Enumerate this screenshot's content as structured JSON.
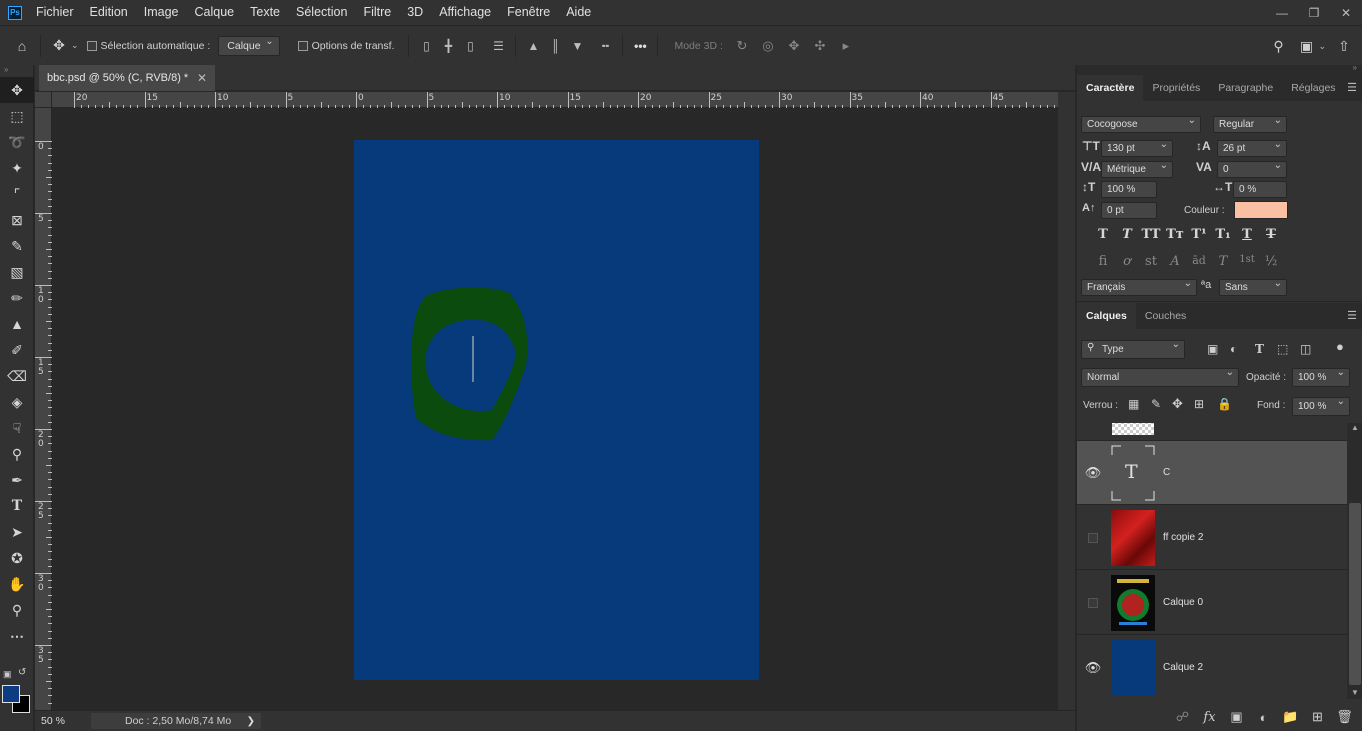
{
  "menu": {
    "logo": "Ps",
    "items": [
      "Fichier",
      "Edition",
      "Image",
      "Calque",
      "Texte",
      "Sélection",
      "Filtre",
      "3D",
      "Affichage",
      "Fenêtre",
      "Aide"
    ],
    "window_controls": [
      "minimize-icon",
      "restore-icon",
      "close-icon"
    ]
  },
  "options": {
    "auto_select_label": "Sélection automatique :",
    "auto_select_checked": false,
    "target_value": "Calque",
    "transform_label": "Options de transf.",
    "transform_checked": false,
    "more": "•••",
    "mode3d_label": "Mode 3D :"
  },
  "document": {
    "tab_title": "bbc.psd @ 50% (C, RVB/8) *",
    "zoom": "50 %",
    "doc_info": "Doc : 2,50 Mo/8,74 Mo",
    "artboard_color": "#063a7a",
    "ruler_h": [
      "20",
      "15",
      "10",
      "5",
      "0",
      "5",
      "10",
      "15",
      "20",
      "25",
      "30",
      "35",
      "40",
      "45"
    ],
    "ruler_v": [
      "0",
      "5",
      "1\n0",
      "1\n5",
      "2\n0",
      "2\n5",
      "3\n0",
      "3\n5"
    ]
  },
  "tools": [
    "move-icon",
    "marquee-icon",
    "lasso-icon",
    "magic-wand-icon",
    "crop-icon",
    "frame-icon",
    "eyedropper-icon",
    "healing-icon",
    "brush-icon",
    "stamp-icon",
    "history-brush-icon",
    "eraser-icon",
    "paint-bucket-icon",
    "smudge-icon",
    "dodge-icon",
    "pen-icon",
    "type-icon",
    "path-select-icon",
    "shape-icon",
    "hand-icon",
    "zoom-icon",
    "more-tools-icon"
  ],
  "colors": {
    "foreground": "#0d3c80",
    "background": "#000000",
    "text_color": "#fbbfa4"
  },
  "character": {
    "tabs": [
      "Caractère",
      "Propriétés",
      "Paragraphe",
      "Réglages"
    ],
    "active_tab": "Caractère",
    "font_family": "Cocogoose",
    "font_style": "Regular",
    "size": "130 pt",
    "leading": "26 pt",
    "kerning": "Métrique",
    "tracking": "0",
    "vscale": "100 %",
    "hscale": "0 %",
    "baseline": "0 pt",
    "color_label": "Couleur :",
    "style_buttons": [
      "T",
      "T",
      "TT",
      "Tт",
      "T¹",
      "T₁",
      "T",
      "T"
    ],
    "opentype_buttons": [
      "fi",
      "ơ",
      "st",
      "A",
      "ād",
      "T",
      "1st",
      "½"
    ],
    "language": "Français",
    "antialias_label": "ªa",
    "antialias": "Sans"
  },
  "layers": {
    "tabs": [
      "Calques",
      "Couches"
    ],
    "active_tab": "Calques",
    "filter": "Type",
    "blend_mode": "Normal",
    "opacity_label": "Opacité :",
    "opacity": "100 %",
    "lock_label": "Verrou :",
    "fill_label": "Fond :",
    "fill": "100 %",
    "items": [
      {
        "name": "C",
        "visible": true,
        "selected": true,
        "thumb": "text"
      },
      {
        "name": "ff copie 2",
        "visible": false,
        "selected": false,
        "thumb": "red"
      },
      {
        "name": "Calque 0",
        "visible": false,
        "selected": false,
        "thumb": "poster"
      },
      {
        "name": "Calque 2",
        "visible": true,
        "selected": false,
        "thumb": "blue"
      }
    ],
    "text_thumb_glyph": "T"
  }
}
